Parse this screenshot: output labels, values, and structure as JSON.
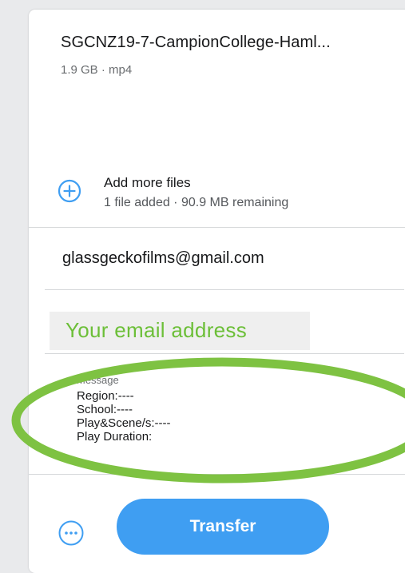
{
  "file": {
    "name": "SGCNZ19-7-CampionCollege-Haml...",
    "meta": "1.9 GB · mp4"
  },
  "add_files": {
    "title": "Add more files",
    "subtitle": "1 file added · 90.9 MB remaining",
    "icon": "plus-circle-icon"
  },
  "form": {
    "email_to": "glassgeckofilms@gmail.com",
    "email_from_placeholder": "Your email address",
    "message_label": "Message",
    "message_lines": [
      "Region:----",
      "School:----",
      "Play&Scene/s:----",
      "Play Duration:"
    ]
  },
  "footer": {
    "more_icon": "more-options-icon",
    "transfer_label": "Transfer"
  },
  "colors": {
    "accent_blue": "#3f9ef2",
    "highlight_green": "#7ec242",
    "placeholder_green": "#6cbf38"
  }
}
